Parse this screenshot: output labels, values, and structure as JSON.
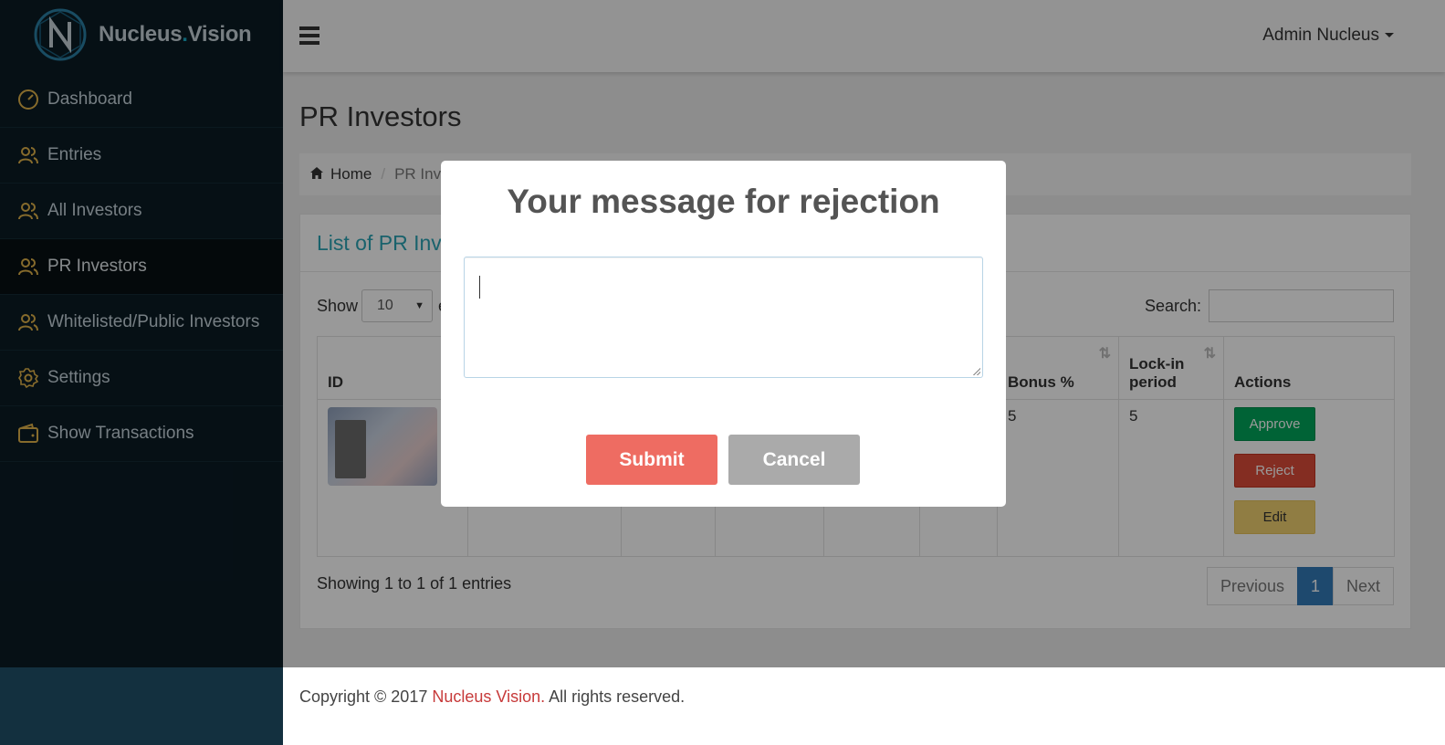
{
  "brand": {
    "name_main": "Nucleus",
    "name_dot": ".",
    "name_tail": "Vision"
  },
  "sidebar": {
    "items": [
      {
        "label": "Dashboard",
        "icon": "dashboard-icon",
        "active": false
      },
      {
        "label": "Entries",
        "icon": "users-icon",
        "active": false
      },
      {
        "label": "All Investors",
        "icon": "users-icon",
        "active": false
      },
      {
        "label": "PR Investors",
        "icon": "users-icon",
        "active": true
      },
      {
        "label": "Whitelisted/Public Investors",
        "icon": "users-icon",
        "active": false
      },
      {
        "label": "Settings",
        "icon": "gear-icon",
        "active": false
      },
      {
        "label": "Show Transactions",
        "icon": "wallet-icon",
        "active": false
      }
    ]
  },
  "header": {
    "user": "Admin Nucleus"
  },
  "page": {
    "title": "PR Investors",
    "breadcrumb": {
      "home": "Home",
      "current": "PR Inve"
    }
  },
  "panel": {
    "title": "List of PR Inve",
    "show_label": "Show",
    "entries_value": "10",
    "entries_suffix": "e",
    "search_label": "Search:",
    "search_value": ""
  },
  "table": {
    "columns": {
      "id": "ID",
      "bonus": "Bonus %",
      "lock_in_1": "Lock-in",
      "lock_in_2": "period",
      "actions": "Actions"
    },
    "row": {
      "bonus": "5",
      "lock_in": "5",
      "approve": "Approve",
      "reject": "Reject",
      "edit": "Edit"
    },
    "showing": "Showing 1 to 1 of 1 entries",
    "pagination": {
      "previous": "Previous",
      "page": "1",
      "next": "Next"
    }
  },
  "footer": {
    "prefix": "Copyright © 2017 ",
    "brand": "Nucleus Vision.",
    "suffix": " All rights reserved."
  },
  "modal": {
    "title": "Your message for rejection",
    "message_value": "",
    "submit": "Submit",
    "cancel": "Cancel"
  },
  "colors": {
    "sidebar_bg": "#0a1b24",
    "accent": "#2aa3b5",
    "submit": "#ee6c62",
    "cancel": "#aaaaaa",
    "approve": "#00a65a",
    "reject": "#dd4b39",
    "edit": "#f0d070"
  }
}
